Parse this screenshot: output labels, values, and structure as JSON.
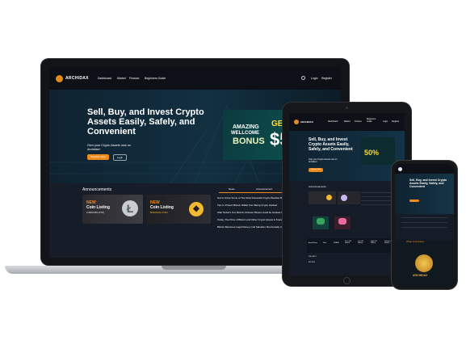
{
  "brand": "ARCHIDAX",
  "nav": {
    "links": [
      "Dashboard",
      "Market",
      "Finance",
      "Beginners Guide"
    ],
    "login": "Login",
    "register": "Register"
  },
  "hero": {
    "title": "Sell, Buy, and Invest Crypto Assets Easily, Safely, and Convenient",
    "subtitle": "Own your Crypto Assets now on Archidax!",
    "register_btn": "Register Here",
    "login_btn": "Login"
  },
  "promo": {
    "line1": "AMAZING",
    "line2": "WELLCOME",
    "line3": "BONUS",
    "get": "GET",
    "amount": "$5"
  },
  "announcements": {
    "title": "Announcements",
    "card1": {
      "new": "NEW",
      "line": "Coin Listing",
      "coin": "LITECOIN (LTC)"
    },
    "card2": {
      "new": "NEW",
      "line": "Coin Listing",
      "coin": "BINANCE COIN"
    },
    "tabs": [
      "News",
      "Announcement"
    ],
    "news": [
      "Get to Know Some of The Most Interested Crypto Besides Bitcoin",
      "Tips to Protect Bitcoin Wallet from Being Crypto Hacked",
      "After Nobel's Cut, Bitcoin Chinese Miners could be Hooked to Sustaina",
      "Today, The Price of Bitcoin and Other Crypto Assets is Sneaking",
      "Bitcoin Becomes Legal Money in El Salvador, But Actually Common"
    ]
  },
  "tablet": {
    "title": "Sell, Buy, and Invest Crypto Assets Easily, Safely, and Convenient",
    "subtitle": "Own your Crypto Assets now on Archidax!",
    "promo_pct": "50%",
    "table_headers": [
      "Asset Name",
      "Rate",
      "PHASE",
      "Price (24 Hours)",
      "Low (24 Hours)",
      "High (24 Hours)",
      "Volume (24 Hours)"
    ],
    "rows": [
      "ZUL/USDT",
      "BTC/IDR"
    ]
  },
  "phone": {
    "title": "Sell, Buy, and Invest Crypto Assets Easily, Safely, and Convenient",
    "section": "What is Archidax",
    "brand_text": "ARCHIDAX"
  },
  "colors": {
    "accent": "#f08a1d",
    "bg": "#0b1a24",
    "promo_green": "#0a7f6a"
  }
}
